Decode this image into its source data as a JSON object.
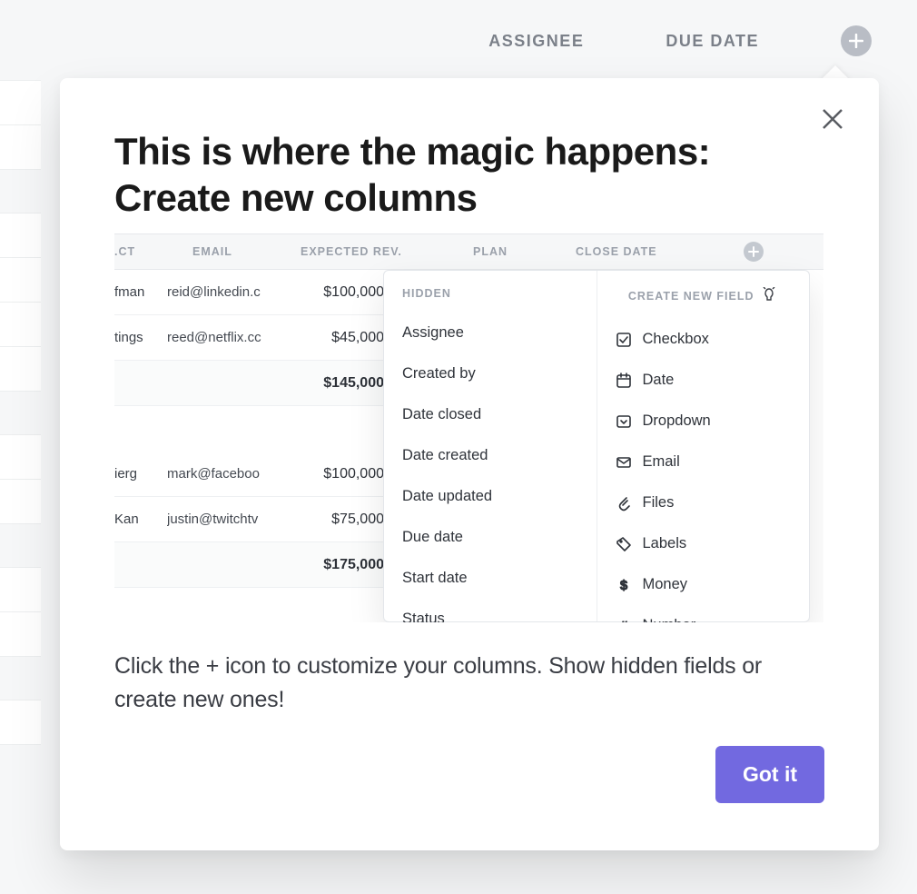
{
  "background": {
    "columns": {
      "assignee": "ASSIGNEE",
      "due_date": "DUE DATE"
    }
  },
  "dialog": {
    "title": "This is where the magic happens: Create new columns",
    "description": "Click the + icon to customize your columns. Show hidden fields or create new ones!",
    "got_it": "Got it"
  },
  "illus": {
    "headers": {
      "ct": ".CT",
      "email": "EMAIL",
      "rev": "EXPECTED REV.",
      "plan": "PLAN",
      "close": "CLOSE DATE"
    },
    "rows": [
      {
        "c1": "fman",
        "c2": "reid@linkedin.c",
        "c3": "$100,000"
      },
      {
        "c1": "tings",
        "c2": "reed@netflix.cc",
        "c3": "$45,000"
      },
      {
        "c1": "",
        "c2": "",
        "c3": "$145,000",
        "total": true
      },
      {
        "c1": "",
        "c2": "",
        "c3": "",
        "blank": true
      },
      {
        "c1": "ierg",
        "c2": "mark@faceboo",
        "c3": "$100,000"
      },
      {
        "c1": "Kan",
        "c2": "justin@twitchtv",
        "c3": "$75,000"
      },
      {
        "c1": "",
        "c2": "",
        "c3": "$175,000",
        "total": true
      }
    ]
  },
  "menu": {
    "hidden_label": "HIDDEN",
    "create_label": "CREATE NEW FIELD",
    "hidden_items": [
      "Assignee",
      "Created by",
      "Date closed",
      "Date created",
      "Date updated",
      "Due date",
      "Start date",
      "Status"
    ],
    "create_items": [
      {
        "icon": "checkbox",
        "label": "Checkbox"
      },
      {
        "icon": "date",
        "label": "Date"
      },
      {
        "icon": "dropdown",
        "label": "Dropdown"
      },
      {
        "icon": "email",
        "label": "Email"
      },
      {
        "icon": "files",
        "label": "Files"
      },
      {
        "icon": "labels",
        "label": "Labels"
      },
      {
        "icon": "money",
        "label": "Money"
      },
      {
        "icon": "number",
        "label": "Number"
      }
    ]
  }
}
